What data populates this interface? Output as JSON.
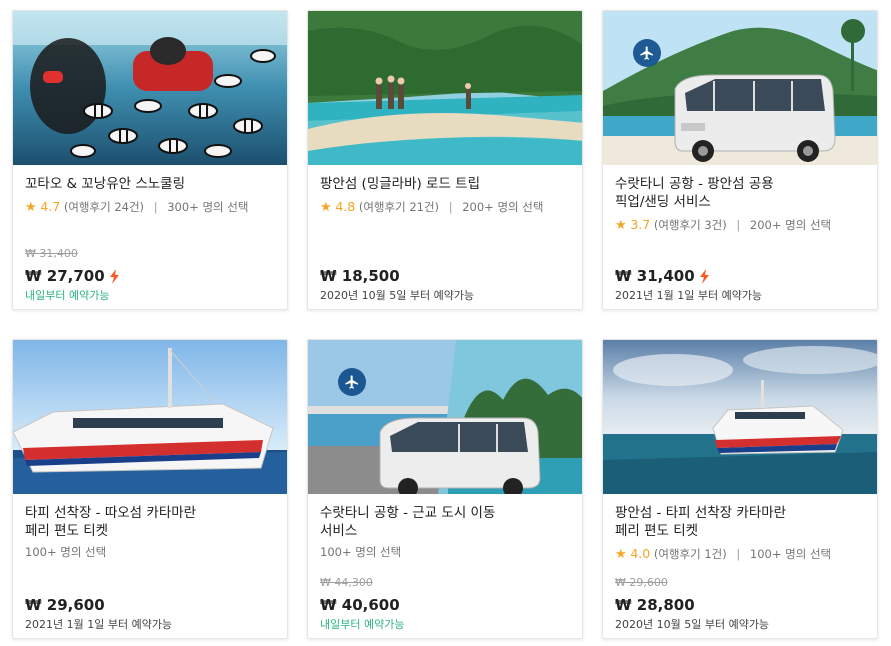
{
  "colors": {
    "star": "#f5a623",
    "green_text": "#2ab37d",
    "bolt": "#ff5722",
    "badge": "#104e8a"
  },
  "cards": [
    {
      "title": "꼬타오 & 꼬낭유안 스노쿨링",
      "star": "★",
      "rating": "4.7",
      "reviews": "(여행후기 24건)",
      "sep": "|",
      "selections": "300+ 명의 선택",
      "original_price": "₩ 31,400",
      "price": "₩ 27,700",
      "instant": true,
      "availability": "내일부터 예약가능",
      "image": "snorkeling-fish"
    },
    {
      "title": "팡안섬 (밍글라바) 로드 트립",
      "star": "★",
      "rating": "4.8",
      "reviews": "(여행후기 21건)",
      "sep": "|",
      "selections": "200+ 명의 선택",
      "price": "₩ 18,500",
      "availability": "2020년 10월 5일 부터 예약가능",
      "image": "tropical-beach"
    },
    {
      "title_line1": "수랏타니 공항 - 팡안섬 공용",
      "title_line2": "픽업/샌딩 서비스",
      "star": "★",
      "rating": "3.7",
      "reviews": "(여행후기 3건)",
      "sep": "|",
      "selections": "200+ 명의 선택",
      "price": "₩ 31,400",
      "instant": true,
      "availability": "2021년 1월 1일 부터 예약가능",
      "image": "white-van-island",
      "badge_icon": "airplane-icon"
    },
    {
      "title_line1": "타피 선착장 - 따오섬 카타마란",
      "title_line2": "페리 편도 티켓",
      "selections": "100+ 명의 선택",
      "price": "₩ 29,600",
      "availability": "2021년 1월 1일 부터 예약가능",
      "image": "catamaran-ferry"
    },
    {
      "title_line1": "수랏타니 공항 - 근교 도시 이동",
      "title_line2": "서비스",
      "selections": "100+ 명의 선택",
      "original_price": "₩ 44,300",
      "price": "₩ 40,600",
      "availability": "내일부터 예약가능",
      "image": "van-airport-collage",
      "badge_icon": "airplane-icon"
    },
    {
      "title_line1": "팡안섬 - 타피 선착장 카타마란",
      "title_line2": "페리 편도 티켓",
      "star": "★",
      "rating": "4.0",
      "reviews": "(여행후기 1건)",
      "sep": "|",
      "selections": "100+ 명의 선택",
      "original_price": "₩ 29,600",
      "price": "₩ 28,800",
      "availability": "2020년 10월 5일 부터 예약가능",
      "image": "catamaran-sea"
    }
  ]
}
